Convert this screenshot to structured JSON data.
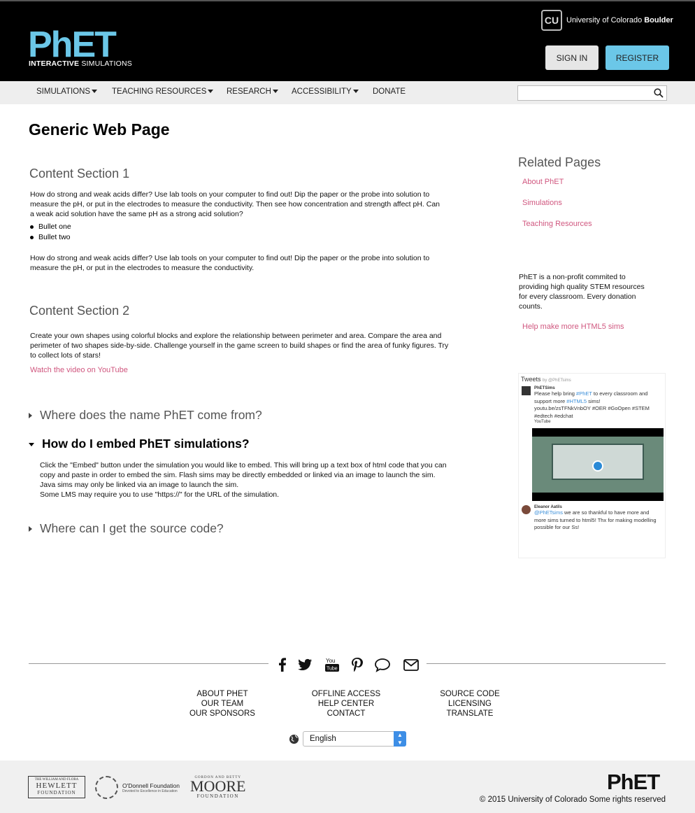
{
  "header": {
    "logo_text": "PhET",
    "logo_sub_bold": "INTERACTIVE",
    "logo_sub": "SIMULATIONS",
    "university_prefix": "University of Colorado",
    "university_bold": "Boulder",
    "university_mark": "CU",
    "signin_label": "SIGN IN",
    "register_label": "REGISTER"
  },
  "nav": {
    "items": [
      {
        "label": "SIMULATIONS",
        "dropdown": true
      },
      {
        "label": "TEACHING RESOURCES",
        "dropdown": true
      },
      {
        "label": "RESEARCH",
        "dropdown": true
      },
      {
        "label": "ACCESSIBILITY",
        "dropdown": true
      },
      {
        "label": "DONATE",
        "dropdown": false
      }
    ],
    "search_value": ""
  },
  "main": {
    "title": "Generic Web Page",
    "section1": {
      "heading": "Content Section 1",
      "para1": "How do strong and weak acids differ? Use lab tools on your computer to find out! Dip the paper or the probe into solution to measure the pH, or put in the electrodes to measure the conductivity. Then see how concentration and strength affect pH. Can a weak acid solution have the same pH as a strong acid solution?",
      "bullets": [
        "Bullet one",
        "Bullet two"
      ],
      "para2": "How do strong and weak acids differ? Use lab tools on your computer to find out! Dip the paper or the probe into solution to measure the pH, or put in the electrodes to measure the conductivity."
    },
    "section2": {
      "heading": "Content Section 2",
      "para": "Create your own shapes using colorful blocks and explore the relationship between perimeter and area. Compare the area and perimeter of two shapes side-by-side. Challenge yourself in the game screen to build shapes or find the area of funky figures. Try to collect lots of stars!",
      "link": "Watch the video on YouTube"
    },
    "accordion": [
      {
        "title": "Where does the name PhET come from?",
        "open": false
      },
      {
        "title": "How do I embed PhET simulations?",
        "open": true,
        "body_line1": "Click the \"Embed\" button under the simulation you would like to embed. This will bring up a text box of html code that you can copy and paste in order to embed the sim. Flash sims may be directly embedded or linked via an image to launch the sim. Java sims may only be linked via an image to launch the sim.",
        "body_line2": "Some LMS may require you to use \"https://\" for the URL of the simulation."
      },
      {
        "title": "Where can I get the source code?",
        "open": false
      }
    ]
  },
  "sidebar": {
    "heading": "Related Pages",
    "links": [
      "About PhET",
      "Simulations",
      "Teaching Resources"
    ],
    "note": "PhET is a non-profit commited to providing high quality STEM resources for every classroom. Every donation counts.",
    "donate_link": "Help make more HTML5 sims",
    "tweets": {
      "header": "Tweets",
      "header_by": "by @PhETsims",
      "t1_name": "PhETSims",
      "t1_text_a": "Please help bring ",
      "t1_tag1": "#PhET",
      "t1_text_b": " to every classroom and support more ",
      "t1_tag2": "#HTML5",
      "t1_text_c": " sims!",
      "t1_link": "youtu.be/zsTFNkVnbOY #OER #GoOpen #STEM #edtech #edchat",
      "t1_source": "YouTube",
      "t2_name": "Eleanor Aatils",
      "t2_tag": "@PhETsims",
      "t2_text": " we are so thankful to have more and more sims turned to html5! Thx for making modelling possible for our Ss!"
    }
  },
  "footer": {
    "social_icons": [
      "facebook-icon",
      "twitter-icon",
      "youtube-icon",
      "pinterest-icon",
      "comment-icon",
      "email-icon"
    ],
    "col1": [
      "ABOUT PHET",
      "OUR TEAM",
      "OUR SPONSORS"
    ],
    "col2": [
      "OFFLINE ACCESS",
      "HELP CENTER",
      "CONTACT"
    ],
    "col3": [
      "SOURCE CODE",
      "LICENSING",
      "TRANSLATE"
    ],
    "language": "English",
    "sponsors": {
      "hewlett_l1": "THE WILLIAM AND FLORA",
      "hewlett_l2": "HEWLETT",
      "hewlett_l3": "FOUNDATION",
      "odonnell_name": "O'Donnell Foundation",
      "odonnell_tag": "Devoted to Excellence in Education",
      "moore_l1": "GORDON AND BETTY",
      "moore_l2": "MOORE",
      "moore_l3": "FOUNDATION"
    },
    "logo_small": "PhET",
    "copyright": "© 2015 University of Colorado  Some rights reserved"
  }
}
